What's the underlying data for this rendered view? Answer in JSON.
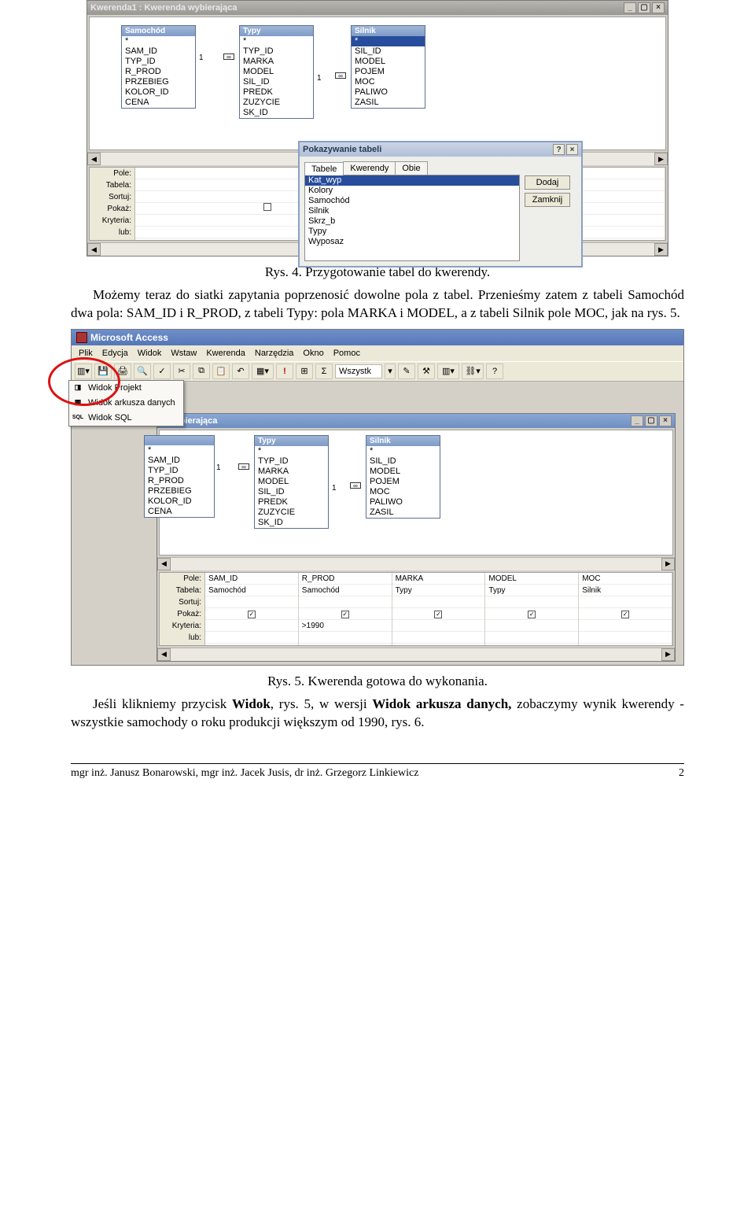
{
  "shot1": {
    "titlebar": "Kwerenda1 : Kwerenda wybierająca",
    "winbtns": {
      "min": "_",
      "max": "▢",
      "close": "×"
    },
    "tables": {
      "samochod": {
        "title": "Samochód",
        "fields": [
          "*",
          "SAM_ID",
          "TYP_ID",
          "R_PROD",
          "PRZEBIEG",
          "KOLOR_ID",
          "CENA"
        ]
      },
      "typy": {
        "title": "Typy",
        "fields": [
          "*",
          "TYP_ID",
          "MARKA",
          "MODEL",
          "SIL_ID",
          "PREDK",
          "ZUZYCIE",
          "SK_ID"
        ]
      },
      "silnik": {
        "title": "Silnik",
        "fields": [
          "*",
          "SIL_ID",
          "MODEL",
          "POJEM",
          "MOC",
          "PALIWO",
          "ZASIL"
        ]
      }
    },
    "join": {
      "one": "1",
      "many": "∞"
    },
    "gridLabels": [
      "Pole:",
      "Tabela:",
      "Sortuj:",
      "Pokaż:",
      "Kryteria:",
      "lub:"
    ],
    "dialog": {
      "title": "Pokazywanie tabeli",
      "tabs": [
        "Tabele",
        "Kwerendy",
        "Obie"
      ],
      "items": [
        "Kat_wyp",
        "Kolory",
        "Samochód",
        "Silnik",
        "Skrz_b",
        "Typy",
        "Wyposaz"
      ],
      "btn_add": "Dodaj",
      "btn_close": "Zamknij",
      "help": "?",
      "close": "×"
    }
  },
  "caption1": "Rys. 4. Przygotowanie tabel do kwerendy.",
  "para1": "Możemy teraz do siatki zapytania poprzenosić dowolne pola z tabel. Przenieśmy zatem z tabeli Samochód dwa pola: SAM_ID i R_PROD, z tabeli Typy: pola MARKA i MODEL, a z tabeli Silnik pole MOC, jak na rys. 5.",
  "shot2": {
    "app_title": "Microsoft Access",
    "menus": [
      "Plik",
      "Edycja",
      "Widok",
      "Wstaw",
      "Kwerenda",
      "Narzędzia",
      "Okno",
      "Pomoc"
    ],
    "toolbar_box_label": "Wszystk",
    "viewmenu": {
      "items": [
        {
          "icon": "◨",
          "label": "Widok Projekt"
        },
        {
          "icon": "▦",
          "label": "Widok arkusza danych"
        },
        {
          "icon": "SQL",
          "label": "Widok SQL"
        }
      ]
    },
    "inner_title_suffix": "wybierająca",
    "winbtns": {
      "min": "_",
      "max": "▢",
      "close": "×"
    },
    "tables": {
      "samochod": {
        "title": "",
        "fields": [
          "*",
          "SAM_ID",
          "TYP_ID",
          "R_PROD",
          "PRZEBIEG",
          "KOLOR_ID",
          "CENA"
        ]
      },
      "typy": {
        "title": "Typy",
        "fields": [
          "*",
          "TYP_ID",
          "MARKA",
          "MODEL",
          "SIL_ID",
          "PREDK",
          "ZUZYCIE",
          "SK_ID"
        ]
      },
      "silnik": {
        "title": "Silnik",
        "fields": [
          "*",
          "SIL_ID",
          "MODEL",
          "POJEM",
          "MOC",
          "PALIWO",
          "ZASIL"
        ]
      }
    },
    "join": {
      "one": "1",
      "many": "∞"
    },
    "gridLabels": [
      "Pole:",
      "Tabela:",
      "Sortuj:",
      "Pokaż:",
      "Kryteria:",
      "lub:"
    ],
    "cols": [
      {
        "pole": "SAM_ID",
        "tabela": "Samochód",
        "kryteria": ""
      },
      {
        "pole": "R_PROD",
        "tabela": "Samochód",
        "kryteria": ">1990"
      },
      {
        "pole": "MARKA",
        "tabela": "Typy",
        "kryteria": ""
      },
      {
        "pole": "MODEL",
        "tabela": "Typy",
        "kryteria": ""
      },
      {
        "pole": "MOC",
        "tabela": "Silnik",
        "kryteria": ""
      }
    ],
    "checkmark": "✓"
  },
  "caption2": "Rys. 5. Kwerenda gotowa do wykonania.",
  "para2_a": "Jeśli klikniemy przycisk ",
  "para2_b": "Widok",
  "para2_c": ", rys. 5, w wersji ",
  "para2_d": "Widok arkusza danych,",
  "para2_e": " zobaczymy wynik kwerendy - wszystkie samochody o roku produkcji większym od 1990, rys. 6.",
  "footer_left": "mgr inż. Janusz Bonarowski, mgr inż. Jacek Jusis, dr inż. Grzegorz Linkiewicz",
  "footer_right": "2"
}
